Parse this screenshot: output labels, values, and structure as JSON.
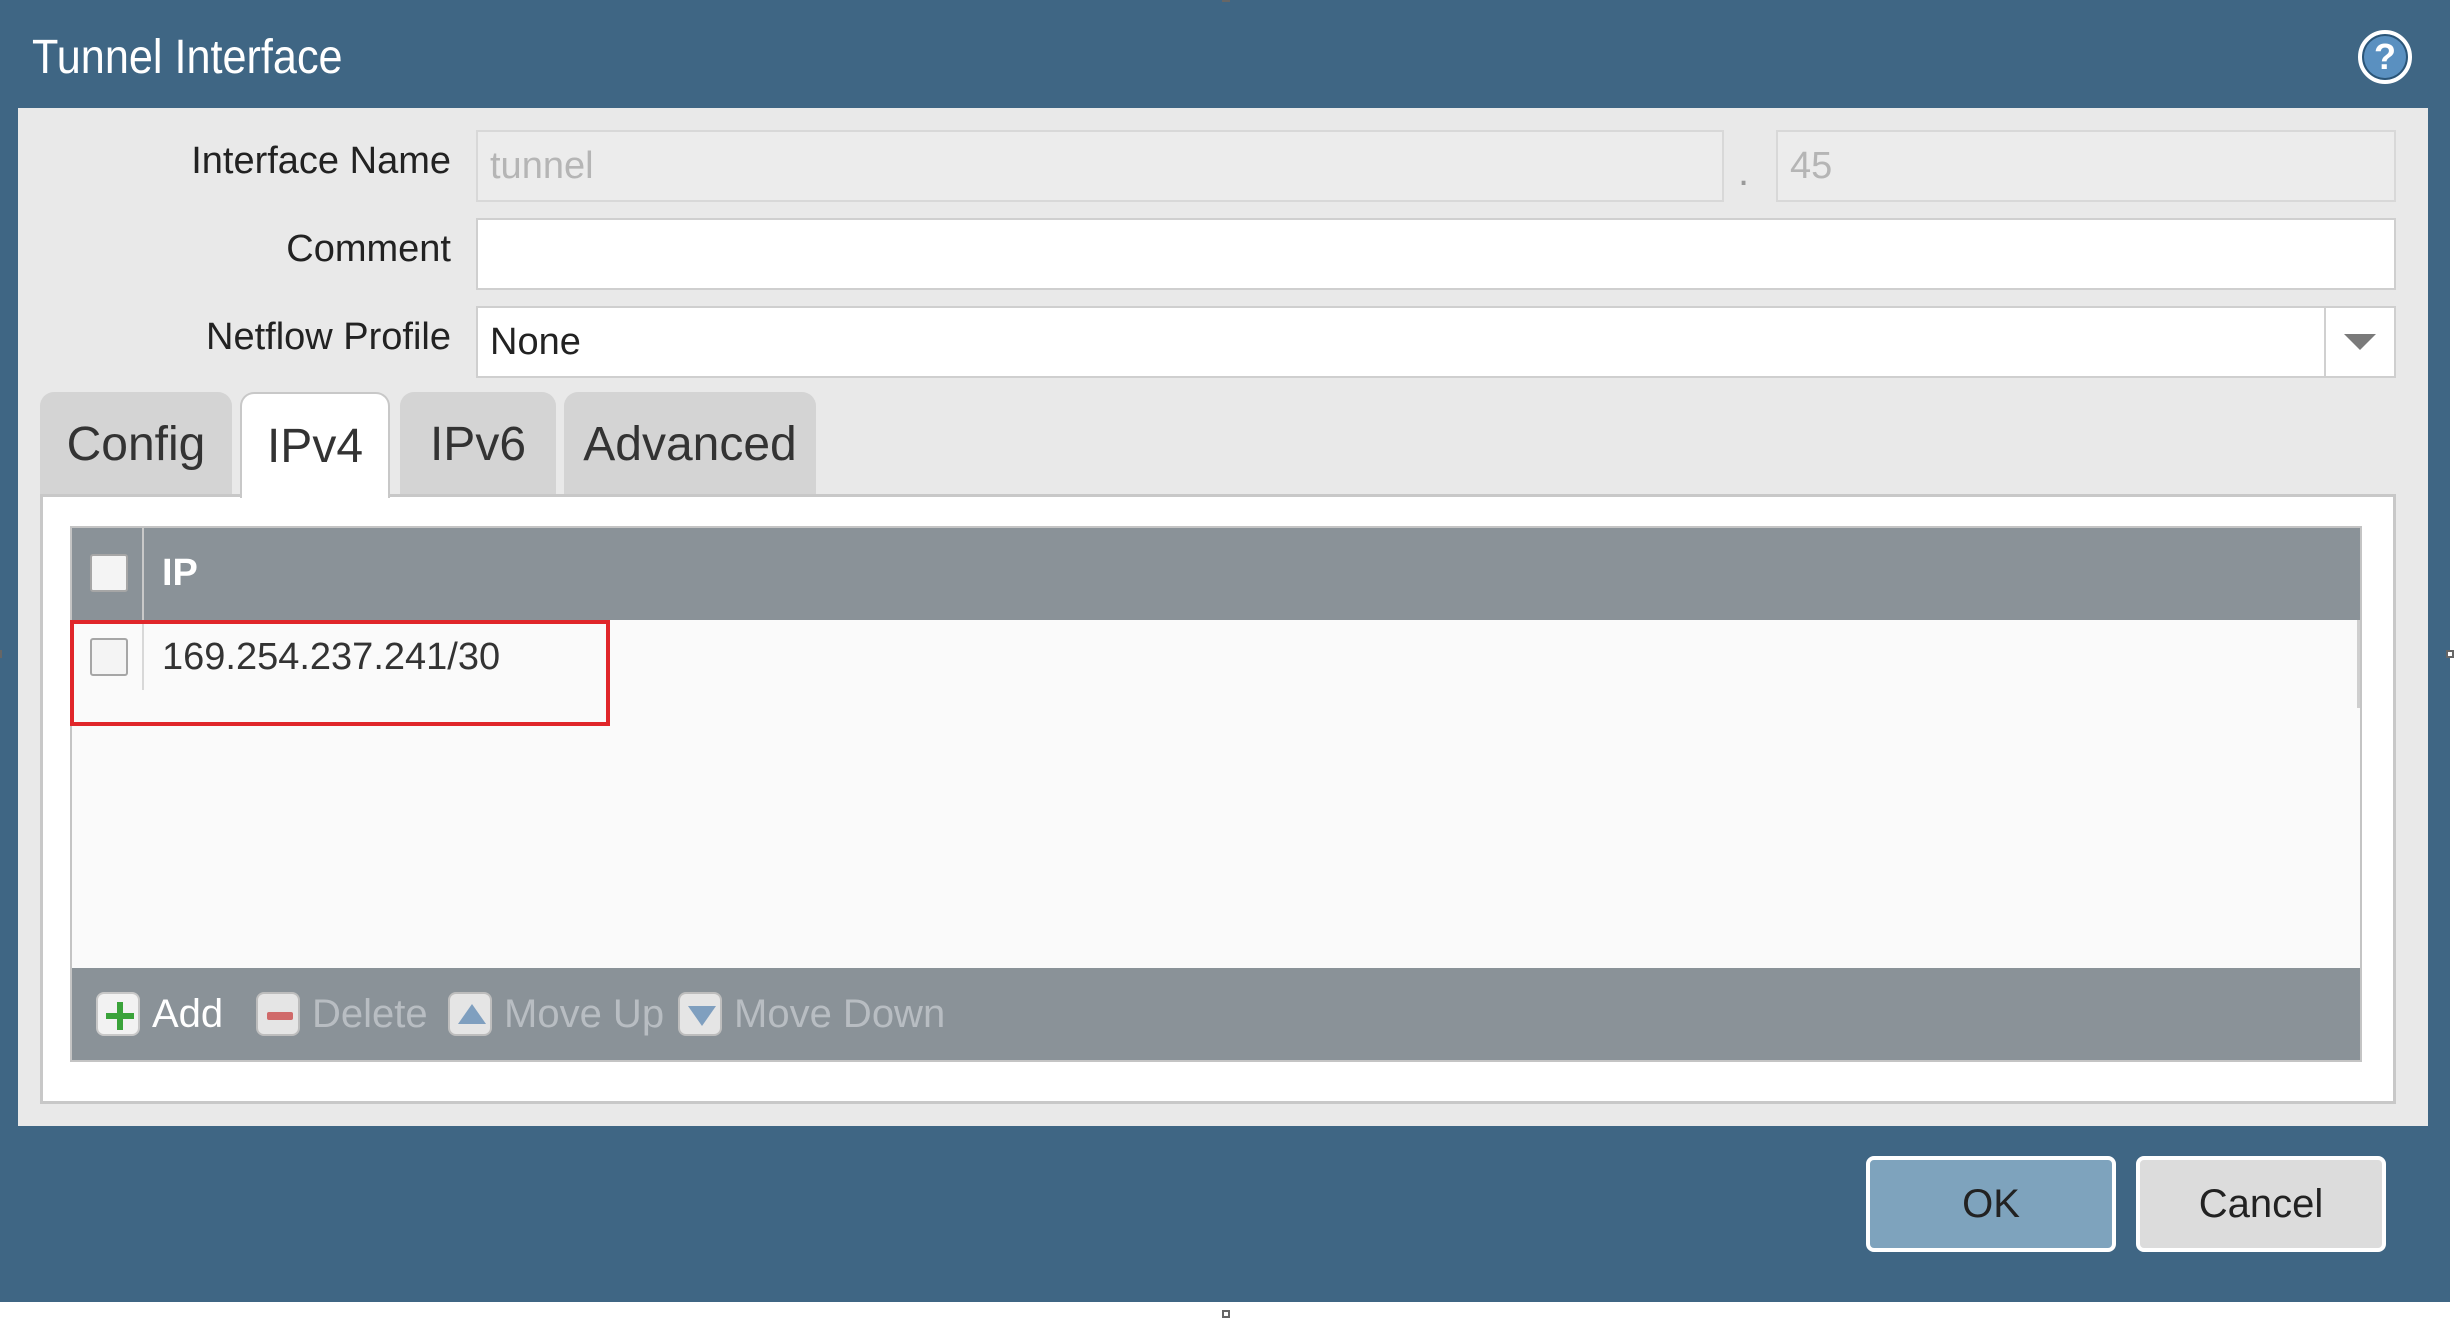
{
  "dialog": {
    "title": "Tunnel Interface",
    "help_icon": "help-icon"
  },
  "form": {
    "interface_name": {
      "label": "Interface Name",
      "value": "tunnel",
      "separator": ".",
      "suffix_value": "45"
    },
    "comment": {
      "label": "Comment",
      "value": ""
    },
    "netflow_profile": {
      "label": "Netflow Profile",
      "value": "None"
    }
  },
  "tabs": [
    {
      "label": "Config",
      "active": false
    },
    {
      "label": "IPv4",
      "active": true
    },
    {
      "label": "IPv6",
      "active": false
    },
    {
      "label": "Advanced",
      "active": false
    }
  ],
  "ip_table": {
    "column_header": "IP",
    "rows": [
      "169.254.237.241/30"
    ]
  },
  "toolbar": {
    "add_label": "Add",
    "delete_label": "Delete",
    "move_up_label": "Move Up",
    "move_down_label": "Move Down"
  },
  "buttons": {
    "ok_label": "OK",
    "cancel_label": "Cancel"
  },
  "colors": {
    "dialog_bg": "#3f6684",
    "highlight": "#e0262a",
    "table_header": "#8a9298"
  }
}
